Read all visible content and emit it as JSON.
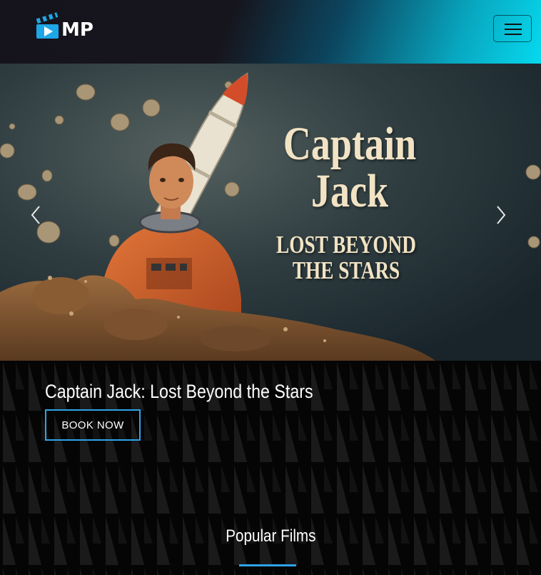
{
  "brand": {
    "logo_text": "MP",
    "accent": "#2ea4e8",
    "logo_color": "#1ea7e6"
  },
  "header": {
    "menu_icon": "hamburger-icon"
  },
  "hero": {
    "title_main_line1": "Captain",
    "title_main_line2": "Jack",
    "title_sub_line1": "LOST BEYOND",
    "title_sub_line2": "THE STARS",
    "prev_icon": "chevron-left-icon",
    "next_icon": "chevron-right-icon"
  },
  "movie": {
    "title": "Captain Jack: Lost Beyond the Stars",
    "book_label": "BOOK NOW"
  },
  "section": {
    "title": "Popular Films"
  }
}
